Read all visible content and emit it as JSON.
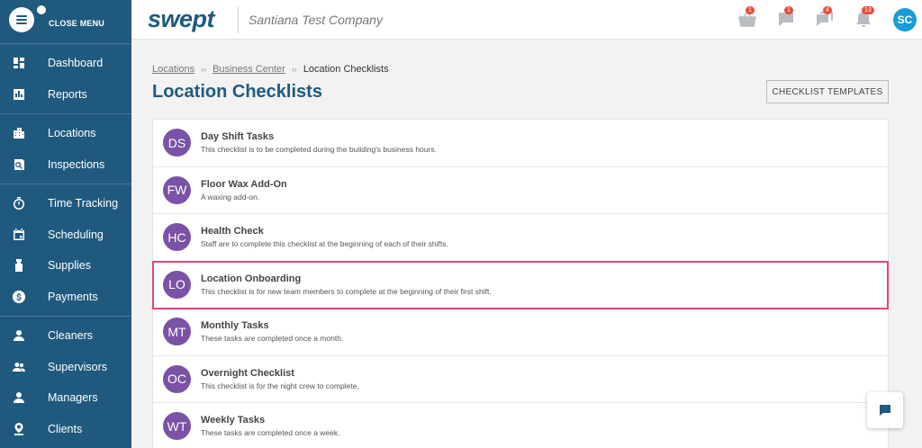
{
  "sidebar": {
    "close_label": "CLOSE MENU",
    "groups": [
      [
        {
          "label": "Dashboard",
          "icon": "dashboard-icon"
        },
        {
          "label": "Reports",
          "icon": "reports-icon"
        }
      ],
      [
        {
          "label": "Locations",
          "icon": "building-icon"
        },
        {
          "label": "Inspections",
          "icon": "inspection-icon"
        }
      ],
      [
        {
          "label": "Time Tracking",
          "icon": "stopwatch-icon"
        },
        {
          "label": "Scheduling",
          "icon": "calendar-icon"
        },
        {
          "label": "Supplies",
          "icon": "spray-bottle-icon"
        },
        {
          "label": "Payments",
          "icon": "dollar-icon"
        }
      ],
      [
        {
          "label": "Cleaners",
          "icon": "cleaner-icon"
        },
        {
          "label": "Supervisors",
          "icon": "supervisors-icon"
        },
        {
          "label": "Managers",
          "icon": "manager-icon"
        },
        {
          "label": "Clients",
          "icon": "client-icon"
        }
      ]
    ]
  },
  "header": {
    "logo": "swept",
    "company": "Santiana Test Company",
    "icons": [
      {
        "name": "basket-icon",
        "badge": "1"
      },
      {
        "name": "chat-icon",
        "badge": "1"
      },
      {
        "name": "messages-icon",
        "badge": "4"
      },
      {
        "name": "bell-icon",
        "badge": "13"
      }
    ],
    "avatar_initials": "SC"
  },
  "breadcrumb": {
    "items": [
      "Locations",
      "Business Center",
      "Location Checklists"
    ]
  },
  "page": {
    "title": "Location Checklists",
    "templates_button": "CHECKLIST TEMPLATES"
  },
  "checklists": [
    {
      "initials": "DS",
      "title": "Day Shift Tasks",
      "desc": "This checklist is to be completed during the building's business hours."
    },
    {
      "initials": "FW",
      "title": "Floor Wax Add-On",
      "desc": "A waxing add-on."
    },
    {
      "initials": "HC",
      "title": "Health Check",
      "desc": "Staff are to complete this checklist at the beginning of each of their shifts."
    },
    {
      "initials": "LO",
      "title": "Location Onboarding",
      "desc": "This checklist is for new team members to complete at the beginning of their first shift.",
      "highlighted": true
    },
    {
      "initials": "MT",
      "title": "Monthly Tasks",
      "desc": "These tasks are completed once a month."
    },
    {
      "initials": "OC",
      "title": "Overnight Checklist",
      "desc": "This checklist is for the night crew to complete."
    },
    {
      "initials": "WT",
      "title": "Weekly Tasks",
      "desc": "These tasks are completed once a week."
    }
  ],
  "colors": {
    "sidebar": "#1f5a7e",
    "avatar": "#7a52a6",
    "highlight": "#e0457b",
    "badge": "#e74c3c"
  }
}
